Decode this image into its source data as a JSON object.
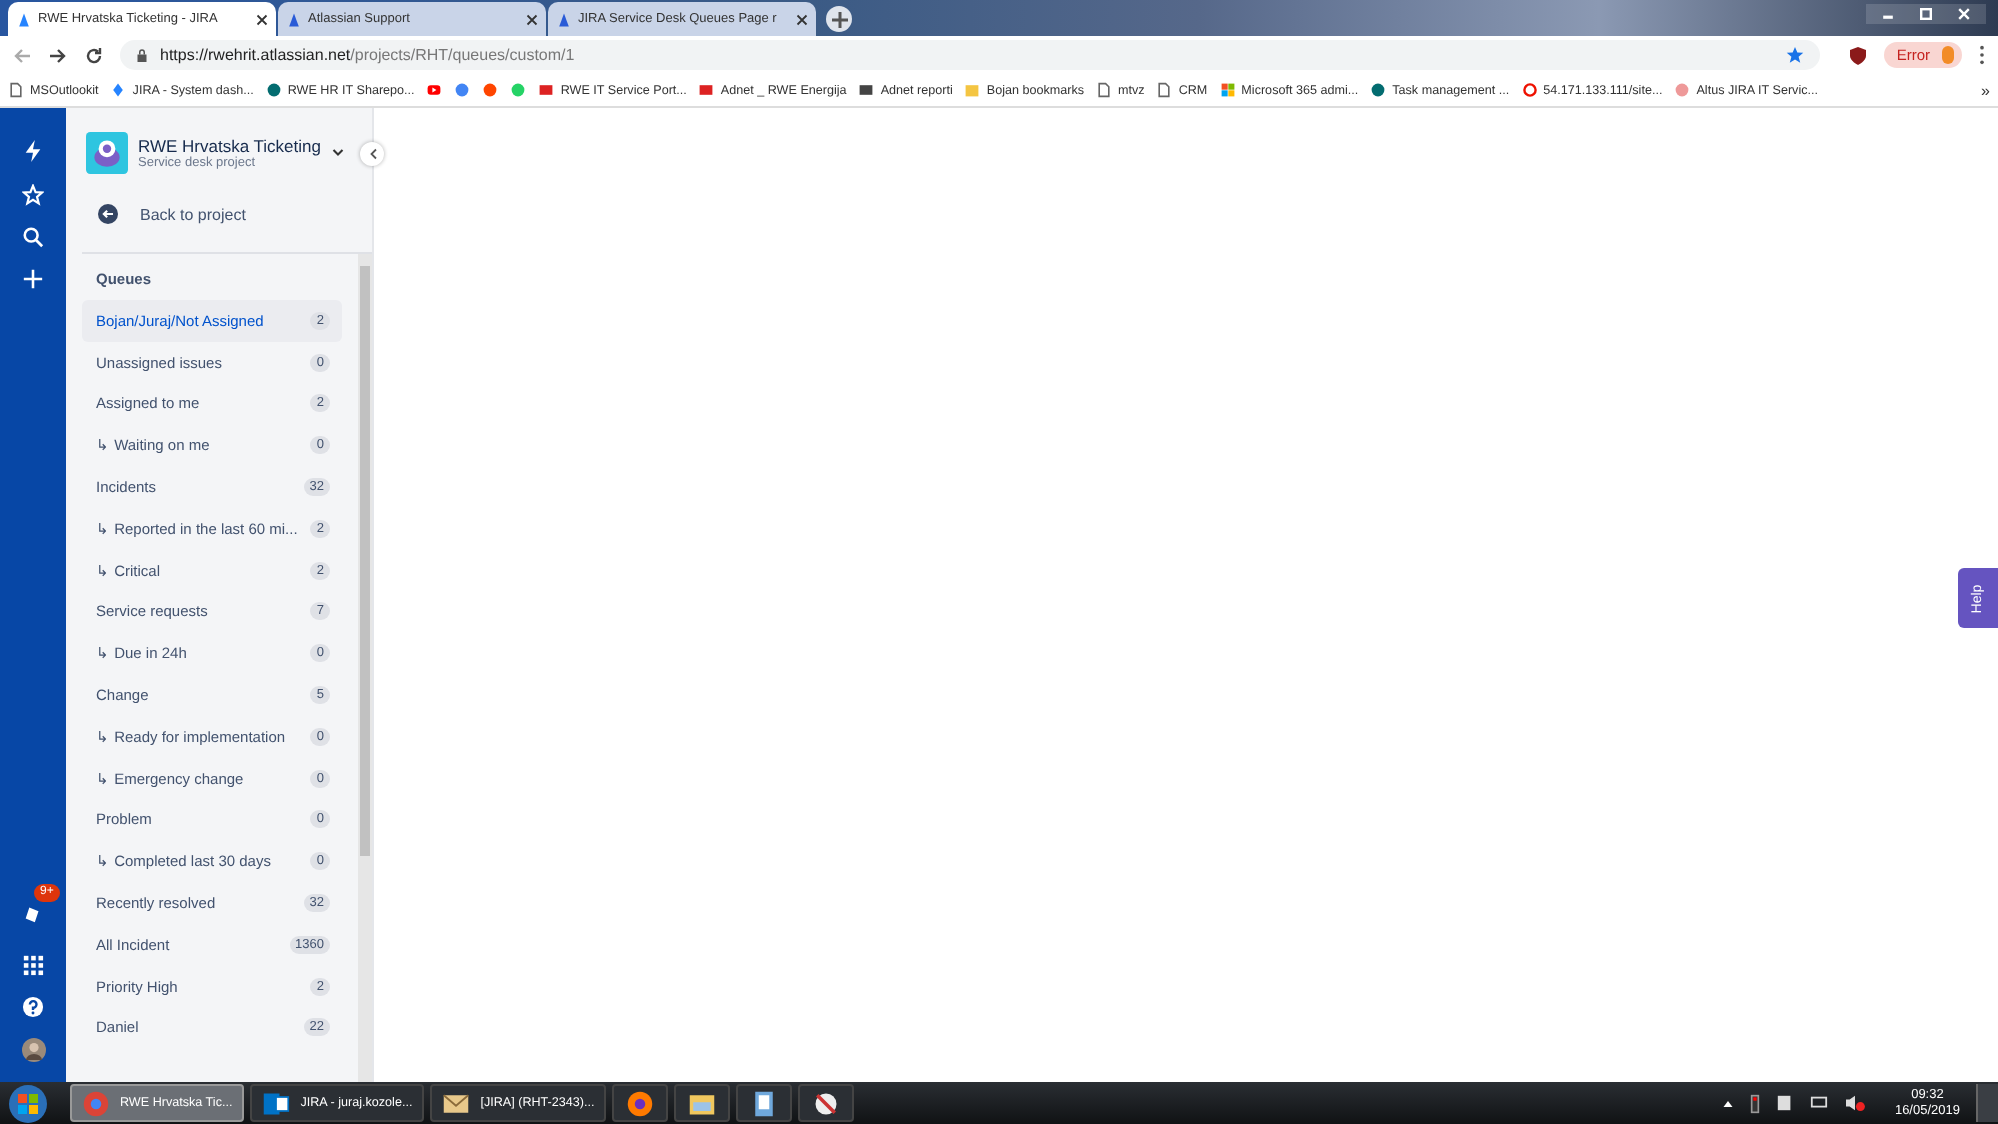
{
  "browser": {
    "tabs": [
      {
        "title": "RWE Hrvatska Ticketing - JIRA",
        "selected": true
      },
      {
        "title": "Atlassian Support",
        "selected": false
      },
      {
        "title": "JIRA Service Desk Queues Page r",
        "selected": false
      }
    ],
    "url_host": "https://rwehrit.atlassian.net",
    "url_path": "/projects/RHT/queues/custom/1",
    "profile_status": "Error",
    "bookmarks": [
      {
        "label": "MSOutlookit",
        "kind": "page"
      },
      {
        "label": "JIRA - System dash...",
        "kind": "jira"
      },
      {
        "label": "RWE HR IT Sharepo...",
        "kind": "sharepoint"
      },
      {
        "kind": "youtube"
      },
      {
        "kind": "google"
      },
      {
        "kind": "reddit"
      },
      {
        "kind": "whatsapp"
      },
      {
        "label": "RWE IT Service Port...",
        "kind": "red"
      },
      {
        "label": "Adnet _ RWE Energija",
        "kind": "red"
      },
      {
        "label": "Adnet reporti",
        "kind": "chart"
      },
      {
        "label": "Bojan bookmarks",
        "kind": "folder"
      },
      {
        "label": "mtvz",
        "kind": "page"
      },
      {
        "label": "CRM",
        "kind": "page"
      },
      {
        "label": "Microsoft 365 admi...",
        "kind": "ms"
      },
      {
        "label": "Task management ...",
        "kind": "sharepoint"
      },
      {
        "label": "54.171.133.111/site...",
        "kind": "opera"
      },
      {
        "label": "Altus JIRA IT Servic...",
        "kind": "altus"
      }
    ],
    "more": "»"
  },
  "project": {
    "name": "RWE Hrvatska Ticketing",
    "type": "Service desk project",
    "back": "Back to project"
  },
  "nav_badge": "9+",
  "queues": {
    "title": "Queues",
    "items": [
      {
        "label": "Bojan/Juraj/Not Assigned",
        "count": "2",
        "selected": true
      },
      {
        "label": "Unassigned issues",
        "count": "0",
        "selected": false
      },
      {
        "label": "Assigned to me",
        "count": "2",
        "selected": false
      },
      {
        "label": "↳ Waiting on me",
        "count": "0",
        "selected": false
      },
      {
        "label": "Incidents",
        "count": "32",
        "selected": false
      },
      {
        "label": "↳ Reported in the last 60 mi...",
        "count": "2",
        "selected": false
      },
      {
        "label": "↳ Critical",
        "count": "2",
        "selected": false
      },
      {
        "label": "Service requests",
        "count": "7",
        "selected": false
      },
      {
        "label": "↳ Due in 24h",
        "count": "0",
        "selected": false
      },
      {
        "label": "Change",
        "count": "5",
        "selected": false
      },
      {
        "label": "↳ Ready for implementation",
        "count": "0",
        "selected": false
      },
      {
        "label": "↳ Emergency change",
        "count": "0",
        "selected": false
      },
      {
        "label": "Problem",
        "count": "0",
        "selected": false
      },
      {
        "label": "↳ Completed last 30 days",
        "count": "0",
        "selected": false
      },
      {
        "label": "Recently resolved",
        "count": "32",
        "selected": false
      },
      {
        "label": "All Incident",
        "count": "1360",
        "selected": false
      },
      {
        "label": "Priority High",
        "count": "2",
        "selected": false
      },
      {
        "label": "Daniel",
        "count": "22",
        "selected": false
      }
    ]
  },
  "help": "Help",
  "taskbar": {
    "items": [
      {
        "label": "RWE Hrvatska Tic...",
        "kind": "chrome",
        "selected": true
      },
      {
        "label": "JIRA - juraj.kozole...",
        "kind": "outlook",
        "selected": false
      },
      {
        "label": "[JIRA] (RHT-2343)...",
        "kind": "mail",
        "selected": false
      },
      {
        "kind": "firefox",
        "selected": false
      },
      {
        "kind": "explorer",
        "selected": false
      },
      {
        "kind": "notepad",
        "selected": false
      },
      {
        "kind": "tool",
        "selected": false
      }
    ],
    "time": "09:32",
    "date": "16/05/2019"
  }
}
